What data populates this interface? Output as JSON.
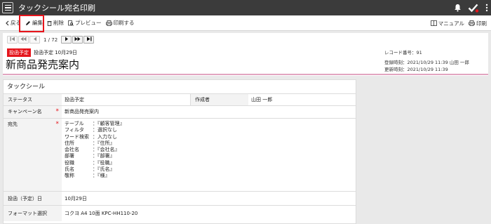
{
  "app": {
    "title": "タックシール宛名印刷"
  },
  "toolbar": {
    "back": "戻る",
    "edit": "編集",
    "delete": "削除",
    "preview": "プレビュー",
    "print": "印刷する",
    "manual": "マニュアル",
    "print_right": "印刷"
  },
  "pager": {
    "count": "1 / 72"
  },
  "header": {
    "status_badge": "投函予定",
    "status_date": "投函予定 10月29日",
    "title": "新商品発売案内",
    "record_no": "レコード番号：91",
    "registered": "登録時刻：2021/10/29 11:39 山田 一郎",
    "updated": "更新時刻：2021/10/29 11:39"
  },
  "section": {
    "title": "タックシール"
  },
  "fields": {
    "status_label": "ステータス",
    "status_value": "投函予定",
    "author_label": "作成者",
    "author_value": "山田 一郎",
    "campaign_label": "キャンペーン名",
    "campaign_value": "新商品発売案内",
    "dest_label": "宛先",
    "dest_lines": [
      {
        "k": "テーブル",
        "v": "：『顧客管理』"
      },
      {
        "k": "フィルタ",
        "v": "：選択なし"
      },
      {
        "k": "ワード検索",
        "v": "：入力なし"
      },
      {
        "k": "住所",
        "v": "：『住所』"
      },
      {
        "k": "会社名",
        "v": "：『会社名』"
      },
      {
        "k": "部署",
        "v": "：『部署』"
      },
      {
        "k": "役職",
        "v": "：『役職』"
      },
      {
        "k": "氏名",
        "v": "：『氏名』"
      },
      {
        "k": "敬称",
        "v": "：『様』"
      }
    ],
    "date_label": "投函（予定）日",
    "date_value": "10月29日",
    "format_label": "フォーマット選択",
    "format_value": "コクヨ A4 10面 KPC-HH110-20"
  },
  "colors": {
    "accent_red": "#e5151c",
    "topbar": "#3b3b3b",
    "pink_line": "#e2a5c0"
  }
}
